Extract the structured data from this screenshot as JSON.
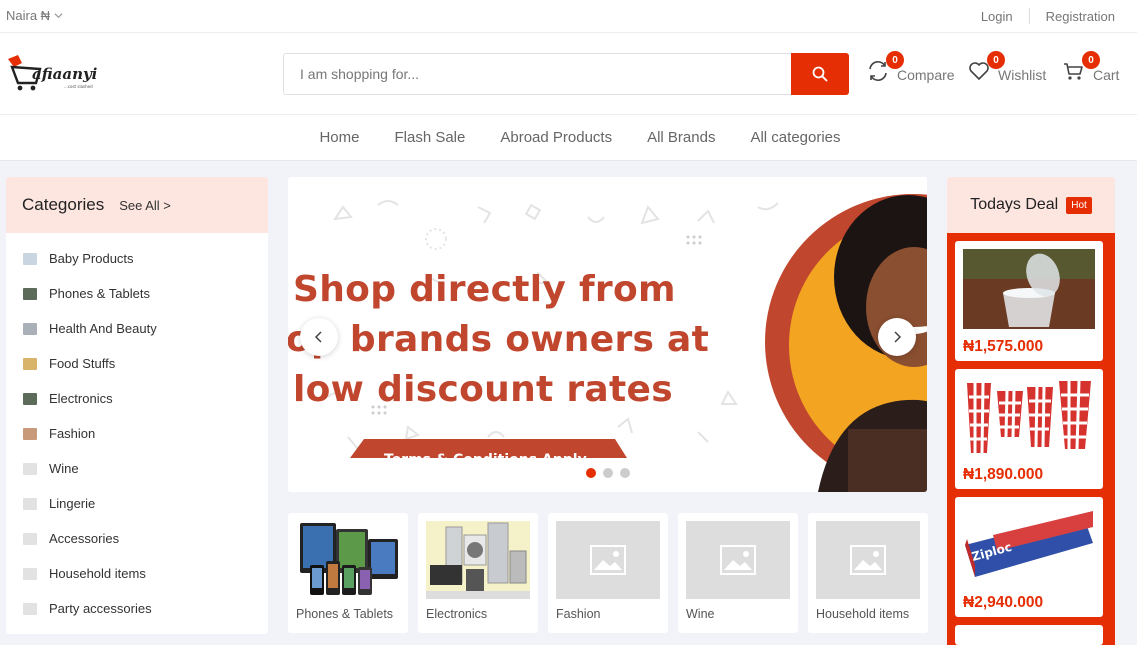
{
  "topbar": {
    "currency": "Naira ₦",
    "login": "Login",
    "registration": "Registration"
  },
  "header": {
    "logo_text": "afiaanyi",
    "search_placeholder": "I am shopping for...",
    "compare": {
      "label": "Compare",
      "count": "0"
    },
    "wishlist": {
      "label": "Wishlist",
      "count": "0"
    },
    "cart": {
      "label": "Cart",
      "count": "0"
    }
  },
  "nav": [
    "Home",
    "Flash Sale",
    "Abroad Products",
    "All Brands",
    "All categories"
  ],
  "categories": {
    "title": "Categories",
    "see_all": "See All >",
    "items": [
      "Baby Products",
      "Phones & Tablets",
      "Health And Beauty",
      "Food Stuffs",
      "Electronics",
      "Fashion",
      "Wine",
      "Lingerie",
      "Accessories",
      "Household items",
      "Party accessories"
    ]
  },
  "banner": {
    "line1": "Shop directly from",
    "line2": "op brands owners at",
    "line3": "low discount rates",
    "terms": "Terms & Conditions Apply",
    "active_slide": 1,
    "slide_count": 3
  },
  "featured": [
    "Phones & Tablets",
    "Electronics",
    "Fashion",
    "Wine",
    "Household items"
  ],
  "deals": {
    "title": "Todays Deal",
    "badge": "Hot",
    "items": [
      {
        "price": "₦1,575.000",
        "image": "plastic-cup"
      },
      {
        "price": "₦1,890.000",
        "image": "paper-cups"
      },
      {
        "price": "₦2,940.000",
        "image": "ziploc-box"
      }
    ]
  },
  "colors": {
    "accent": "#e62e04",
    "head_bg": "#fde5e0",
    "banner_text": "#c0462e"
  }
}
